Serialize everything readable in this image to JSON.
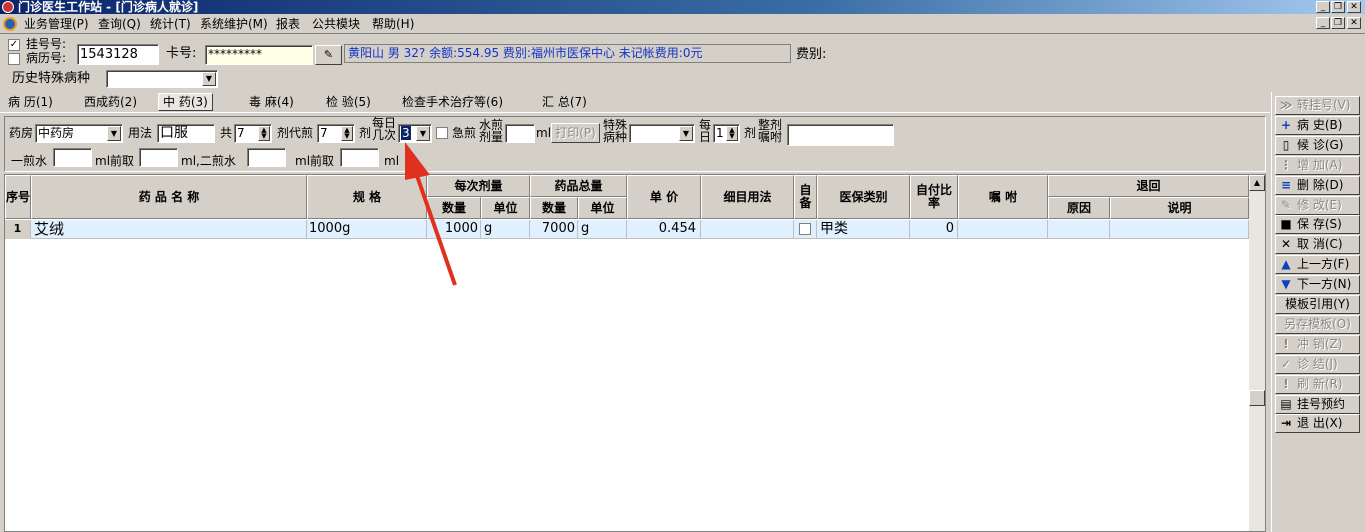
{
  "window": {
    "title": "门诊医生工作站 - [门诊病人就诊]"
  },
  "menu": [
    "业务管理(P)",
    "查询(Q)",
    "统计(T)",
    "系统维护(M)",
    "报表",
    "公共模块",
    "帮助(H)"
  ],
  "patient": {
    "reg_label": "挂号号:",
    "record_label": "病历号:",
    "reg_checked": true,
    "reg_no": "1543128",
    "card_label": "卡号:",
    "card_no": "*********",
    "info": "黄阳山 男 32? 余额:554.95 费别:福州市医保中心 未记帐费用:0元",
    "fee_type_label": "费别:",
    "special_disease_label": "历史特殊病种",
    "special_disease_value": ""
  },
  "tabs": [
    "病 历(1)",
    "西成药(2)",
    "中 药(3)",
    "毒 麻(4)",
    "检 验(5)",
    "检查手术治疗等(6)",
    "汇 总(7)"
  ],
  "active_tab": 2,
  "herb_form": {
    "pharmacy_label": "药房",
    "pharmacy": "中药房",
    "usage_label": "用法",
    "usage": "口服",
    "total_label": "共",
    "total": "7",
    "dose_sub_label": "剂代煎",
    "dose_sub": "7",
    "dose_unit": "剂",
    "daily_label_1": "每日",
    "daily_label_2": "几次",
    "daily_times": "3",
    "urgent_label": "急煎",
    "water_label_1": "水煎",
    "water_label_2": "剂量",
    "ml": "ml",
    "print_button": "打印(P)",
    "special_label_1": "特殊",
    "special_label_2": "病种",
    "per_day_label_1": "每",
    "per_day_label_2": "日",
    "per_day": "1",
    "per_day_unit": "剂",
    "instruction_label_1": "整剂",
    "instruction_label_2": "嘱咐",
    "first_water_label": "一煎水",
    "first_take_label": "ml前取",
    "second_water_label": "ml,二煎水",
    "second_take_label": "ml前取",
    "ml_end": "ml"
  },
  "table": {
    "headers": {
      "seq": "序号",
      "name": "药 品 名 称",
      "spec": "规 格",
      "per_dose": "每次剂量",
      "total_qty": "药品总量",
      "qty": "数量",
      "unit": "单位",
      "price": "单 价",
      "usage": "细目用法",
      "self": "自备",
      "insurance": "医保类别",
      "self_pay": "自付比率",
      "note": "嘱 咐",
      "return": "退回",
      "reason": "原因",
      "desc": "说明"
    },
    "rows": [
      {
        "seq": "1",
        "name": "艾绒",
        "spec": "1000g",
        "dose_qty": "1000",
        "dose_unit": "g",
        "total_qty": "7000",
        "total_unit": "g",
        "price": "0.454",
        "usage": "",
        "self": false,
        "insurance": "甲类",
        "self_pay": "0",
        "note": "",
        "reason": "",
        "desc": ""
      }
    ]
  },
  "side_buttons": [
    {
      "label": "转挂号(V)",
      "icon": "≫",
      "enabled": false
    },
    {
      "label": "病 史(B)",
      "icon": "+",
      "enabled": true
    },
    {
      "label": "候 诊(G)",
      "icon": "▯",
      "enabled": true
    },
    {
      "label": "增 加(A)",
      "icon": "⋮",
      "enabled": false
    },
    {
      "label": "删 除(D)",
      "icon": "≡",
      "enabled": true
    },
    {
      "label": "修 改(E)",
      "icon": "✎",
      "enabled": false
    },
    {
      "label": "保 存(S)",
      "icon": "■",
      "enabled": true
    },
    {
      "label": "取 消(C)",
      "icon": "✕",
      "enabled": true
    },
    {
      "label": "上一方(F)",
      "icon": "▲",
      "enabled": true
    },
    {
      "label": "下一方(N)",
      "icon": "▼",
      "enabled": true
    },
    {
      "label": "模板引用(Y)",
      "icon": "",
      "enabled": true
    },
    {
      "label": "另存模板(O)",
      "icon": "",
      "enabled": false
    },
    {
      "label": "冲 销(Z)",
      "icon": "!",
      "enabled": false
    },
    {
      "label": "诊 结(J)",
      "icon": "✓",
      "enabled": false
    },
    {
      "label": "刷 新(R)",
      "icon": "!",
      "enabled": false
    },
    {
      "label": "挂号预约",
      "icon": "▤",
      "enabled": true
    },
    {
      "label": "退 出(X)",
      "icon": "⇥",
      "enabled": true
    }
  ]
}
